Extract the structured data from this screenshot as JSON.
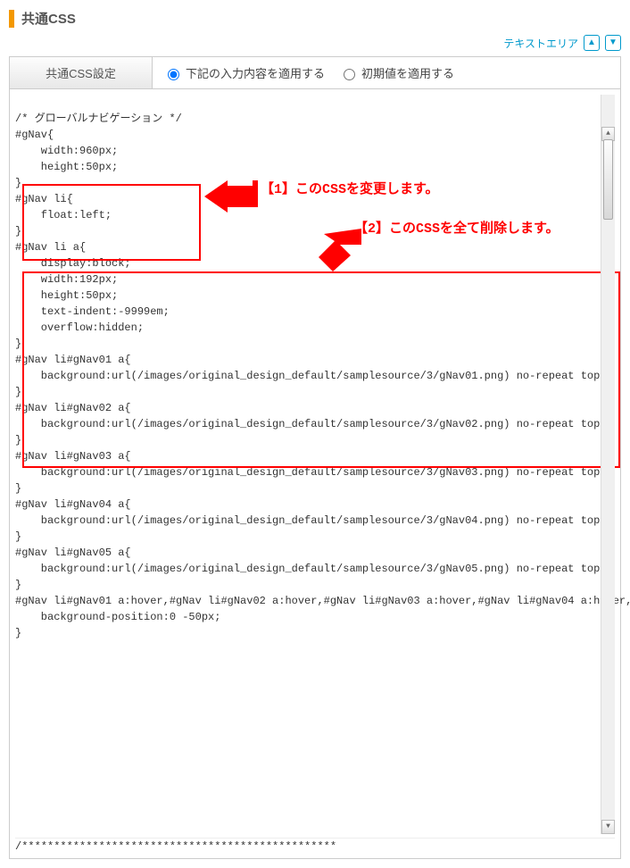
{
  "page": {
    "title": "共通CSS"
  },
  "toolbar": {
    "text_area_link": "テキストエリア"
  },
  "tab": {
    "label": "共通CSS設定"
  },
  "options": {
    "apply_input": "下記の入力内容を適用する",
    "apply_default": "初期値を適用する"
  },
  "callouts": {
    "c1": "【1】このCSSを変更します。",
    "c2": "【2】このCSSを全て削除します。"
  },
  "code": {
    "comment_head": "/* グローバルナビゲーション */",
    "block_gnav": "#gNav{\n    width:960px;\n    height:50px;\n}",
    "block_li": "#gNav li{\n    float:left;\n}",
    "block_a": "#gNav li a{\n    display:block;\n    width:192px;\n    height:50px;\n    text-indent:-9999em;\n    overflow:hidden;\n}",
    "nav_rules": "#gNav li#gNav01 a{\n    background:url(/images/original_design_default/samplesource/3/gNav01.png) no-repeat top;\n}\n#gNav li#gNav02 a{\n    background:url(/images/original_design_default/samplesource/3/gNav02.png) no-repeat top;\n}\n#gNav li#gNav03 a{\n    background:url(/images/original_design_default/samplesource/3/gNav03.png) no-repeat top;\n}\n#gNav li#gNav04 a{\n    background:url(/images/original_design_default/samplesource/3/gNav04.png) no-repeat top;\n}\n#gNav li#gNav05 a{\n    background:url(/images/original_design_default/samplesource/3/gNav05.png) no-repeat top;\n}\n#gNav li#gNav01 a:hover,#gNav li#gNav02 a:hover,#gNav li#gNav03 a:hover,#gNav li#gNav04 a:hover,#gNav li#gNav\n    background-position:0 -50px;\n}",
    "foot_comment": "/*************************************************"
  }
}
